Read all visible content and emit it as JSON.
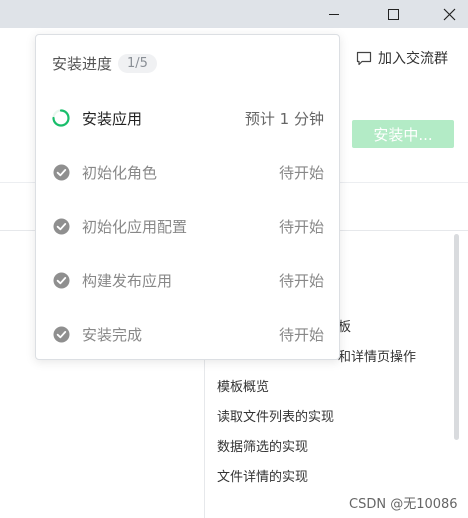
{
  "window": {
    "buttons": [
      "minimize",
      "maximize",
      "close"
    ]
  },
  "header": {
    "join_group_label": "加入交流群",
    "join_group_icon": "chat-bubble-icon"
  },
  "toolbar": {
    "install_button_label": "安装中...",
    "install_button_color": "#b3ebc6"
  },
  "docs": {
    "partial_items": [
      "板",
      "和详情页操作"
    ],
    "items": [
      "模板概览",
      "读取文件列表的实现",
      "数据筛选的实现",
      "文件详情的实现"
    ]
  },
  "watermark": "CSDN @无10086",
  "install_progress": {
    "title": "安装进度",
    "step_counter": "1/5",
    "accent_color": "#19be6b",
    "steps": [
      {
        "name": "安装应用",
        "status": "预计 1 分钟",
        "state": "in-progress"
      },
      {
        "name": "初始化角色",
        "status": "待开始",
        "state": "pending"
      },
      {
        "name": "初始化应用配置",
        "status": "待开始",
        "state": "pending"
      },
      {
        "name": "构建发布应用",
        "status": "待开始",
        "state": "pending"
      },
      {
        "name": "安装完成",
        "status": "待开始",
        "state": "pending"
      }
    ]
  }
}
